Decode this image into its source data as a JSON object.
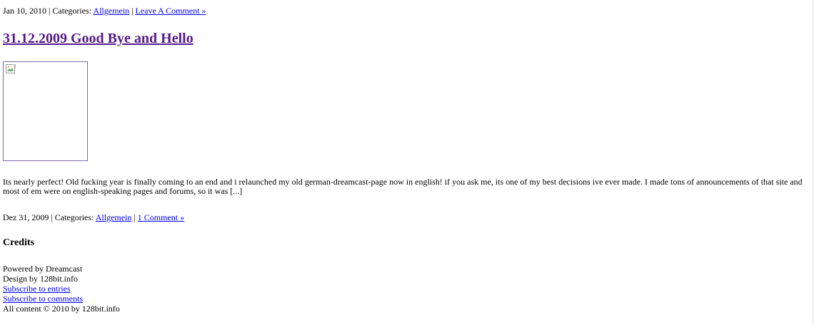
{
  "post_prev": {
    "meta": {
      "date": "Jan 10, 2010",
      "separator": "|",
      "categories_label": "Categories:",
      "category": "Allgemein",
      "comment_link": "Leave A Comment »"
    }
  },
  "post": {
    "title": "31.12.2009 Good Bye and Hello",
    "image_icon": "broken-image-icon",
    "excerpt": "Its nearly perfect! Old fucking year is finally coming to an end and i relaunched my old german-dreamcast-page now in english! if you ask me, its one of my best decisions ive ever made. I made tons of announcements of that site and most of em were on english-speaking pages and forums, so it was [...]",
    "meta": {
      "date": "Dez 31, 2009",
      "separator": "|",
      "categories_label": "Categories:",
      "category": "Allgemein",
      "comment_link": "1 Comment »"
    }
  },
  "credits": {
    "title": "Credits",
    "powered_by": "Powered by Dreamcast",
    "design_by": "Design by 128bit.info",
    "subscribe_entries": "Subscribe to entries",
    "subscribe_comments": "Subscribe to comments",
    "copyright": "All content © 2010 by 128bit.info"
  },
  "colors": {
    "link": "#0000ee",
    "visited_link": "#551a8b",
    "text": "#000000",
    "background": "#ffffff"
  }
}
